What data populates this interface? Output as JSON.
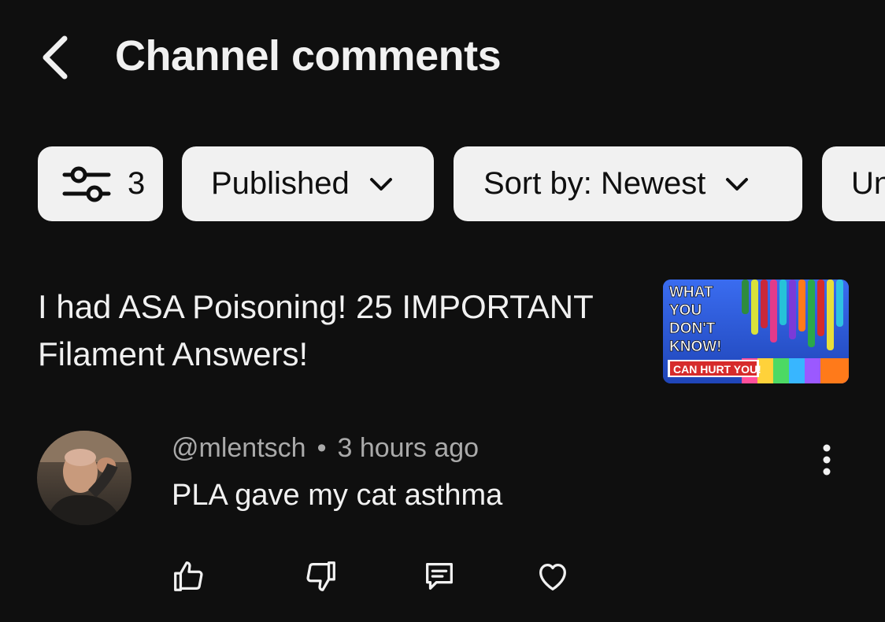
{
  "header": {
    "title": "Channel comments",
    "back_icon": "chevron-left-icon"
  },
  "filters": {
    "filter_count": "3",
    "published_label": "Published",
    "sort_label": "Sort by: Newest",
    "overflow_chip_label": "Unread"
  },
  "video": {
    "title": "I had ASA Poisoning! 25 IMPORTANT Filament Answers!",
    "thumbnail": {
      "lines": [
        "WHAT",
        "YOU",
        "DON'T",
        "KNOW!"
      ],
      "banner": "CAN HURT YOU!"
    }
  },
  "comment": {
    "author": "@mlentsch",
    "separator": "•",
    "time": "3 hours ago",
    "text": "PLA gave my cat asthma"
  },
  "actions": {
    "icons": [
      "thumbs-up-icon",
      "thumbs-down-icon",
      "reply-icon",
      "heart-icon"
    ]
  },
  "colors": {
    "background": "#0f0f0f",
    "chip_bg": "#f1f1f1",
    "text_primary": "#f1f1f1",
    "text_secondary": "#aaaaaa"
  }
}
